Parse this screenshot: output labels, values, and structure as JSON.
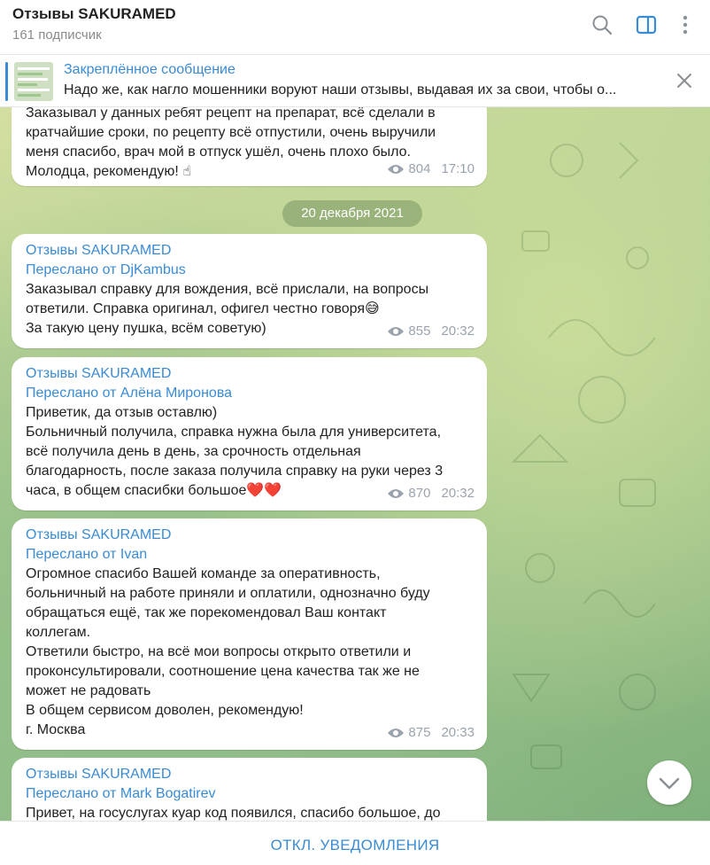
{
  "header": {
    "title": "Отзывы SAKURAMED",
    "subtitle": "161 подписчик",
    "icons": [
      "search-icon",
      "sidebar-toggle-icon",
      "more-vert-icon"
    ]
  },
  "pinned": {
    "label": "Закреплённое сообщение",
    "text": "Надо же, как нагло мошенники воруют наши отзывы, выдавая их за свои, чтобы о..."
  },
  "date_separator": "20 декабря 2021",
  "messages": [
    {
      "text": "Заказывал у данных ребят рецепт на препарат, всё сделали в\nкратчайшие сроки, по рецепту всё отпустили, очень выручили\nменя спасибо, врач мой в отпуск ушёл, очень плохо было.\nМолодца, рекомендую! ☝",
      "views": "804",
      "time": "17:10"
    },
    {
      "author": "Отзывы SAKURAMED",
      "forwarded": "Переслано от DjKambus",
      "text": "Заказывал справку для вождения, всё прислали, на вопросы\nответили. Справка оригинал, офигел честно говоря😅\nЗа такую цену пушка, всём советую)",
      "views": "855",
      "time": "20:32"
    },
    {
      "author": "Отзывы SAKURAMED",
      "forwarded": "Переслано от Алёна Миронова",
      "text": "Приветик, да отзыв оставлю)\nБольничный получила, справка нужна была для университета,\nвсё получила день в день, за срочность отдельная\nблагодарность, после заказа получила справку на руки через 3\nчаса, в общем спасибки большое❤️❤️",
      "views": "870",
      "time": "20:32"
    },
    {
      "author": "Отзывы SAKURAMED",
      "forwarded": "Переслано от Ivan",
      "text": "Огромное спасибо Вашей команде за оперативность,\nбольничный на работе приняли и оплатили, однозначно буду\nобращаться ещё, так же порекомендовал Ваш контакт\nколлегам.\nОтветили быстро, на всё мои вопросы открыто ответили и\nпроконсультировали, соотношение цена качества так же не\nможет не радовать\nВ общем сервисом доволен, рекомендую!\nг. Москва",
      "views": "875",
      "time": "20:33"
    },
    {
      "author": "Отзывы SAKURAMED",
      "forwarded": "Переслано от Mark Bogatirev",
      "text": "Привет, на госуслугах куар код появился, спасибо большое, до",
      "views": "",
      "time": ""
    }
  ],
  "bottom_button": "ОТКЛ. УВЕДОМЛЕНИЯ",
  "colors": {
    "accent": "#3a8bd6",
    "meta": "#9aa3ad"
  }
}
